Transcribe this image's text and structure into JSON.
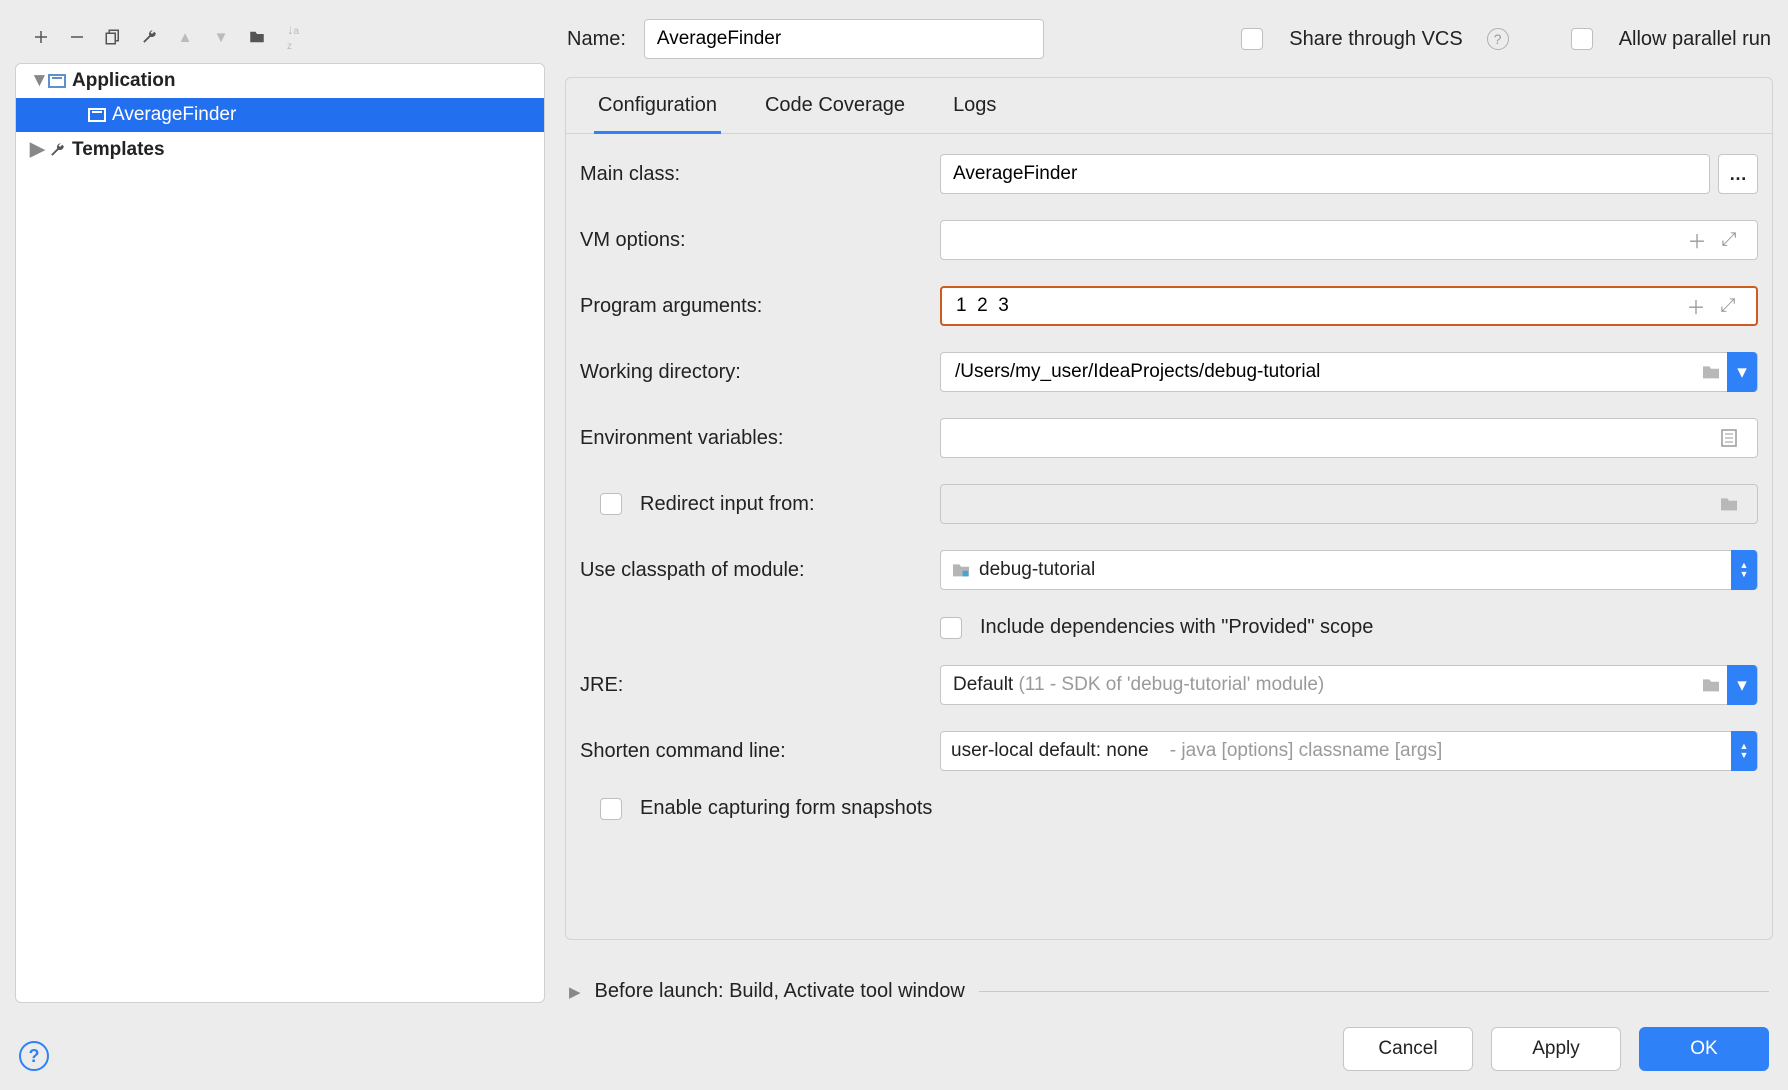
{
  "toolbar": {},
  "tree": {
    "application_label": "Application",
    "config_name": "AverageFinder",
    "templates_label": "Templates"
  },
  "header": {
    "name_label": "Name:",
    "name_value": "AverageFinder",
    "share_label": "Share through VCS",
    "parallel_label": "Allow parallel run"
  },
  "tabs": {
    "configuration": "Configuration",
    "coverage": "Code Coverage",
    "logs": "Logs"
  },
  "form": {
    "main_class_label": "Main class:",
    "main_class_value": "AverageFinder",
    "vm_label": "VM options:",
    "vm_value": "",
    "args_label": "Program arguments:",
    "args_value": "1  2  3",
    "wd_label": "Working directory:",
    "wd_value": "/Users/my_user/IdeaProjects/debug-tutorial",
    "env_label": "Environment variables:",
    "env_value": "",
    "redirect_label": "Redirect input from:",
    "redirect_value": "",
    "classpath_label": "Use classpath of module:",
    "classpath_value": "debug-tutorial",
    "provided_label": "Include dependencies with \"Provided\" scope",
    "jre_label": "JRE:",
    "jre_value": "Default",
    "jre_hint": "(11 - SDK of 'debug-tutorial' module)",
    "shorten_label": "Shorten command line:",
    "shorten_value": "user-local default: none",
    "shorten_hint": "- java [options] classname [args]",
    "snapshots_label": "Enable capturing form snapshots"
  },
  "before_launch_label": "Before launch: Build, Activate tool window",
  "buttons": {
    "cancel": "Cancel",
    "apply": "Apply",
    "ok": "OK"
  }
}
